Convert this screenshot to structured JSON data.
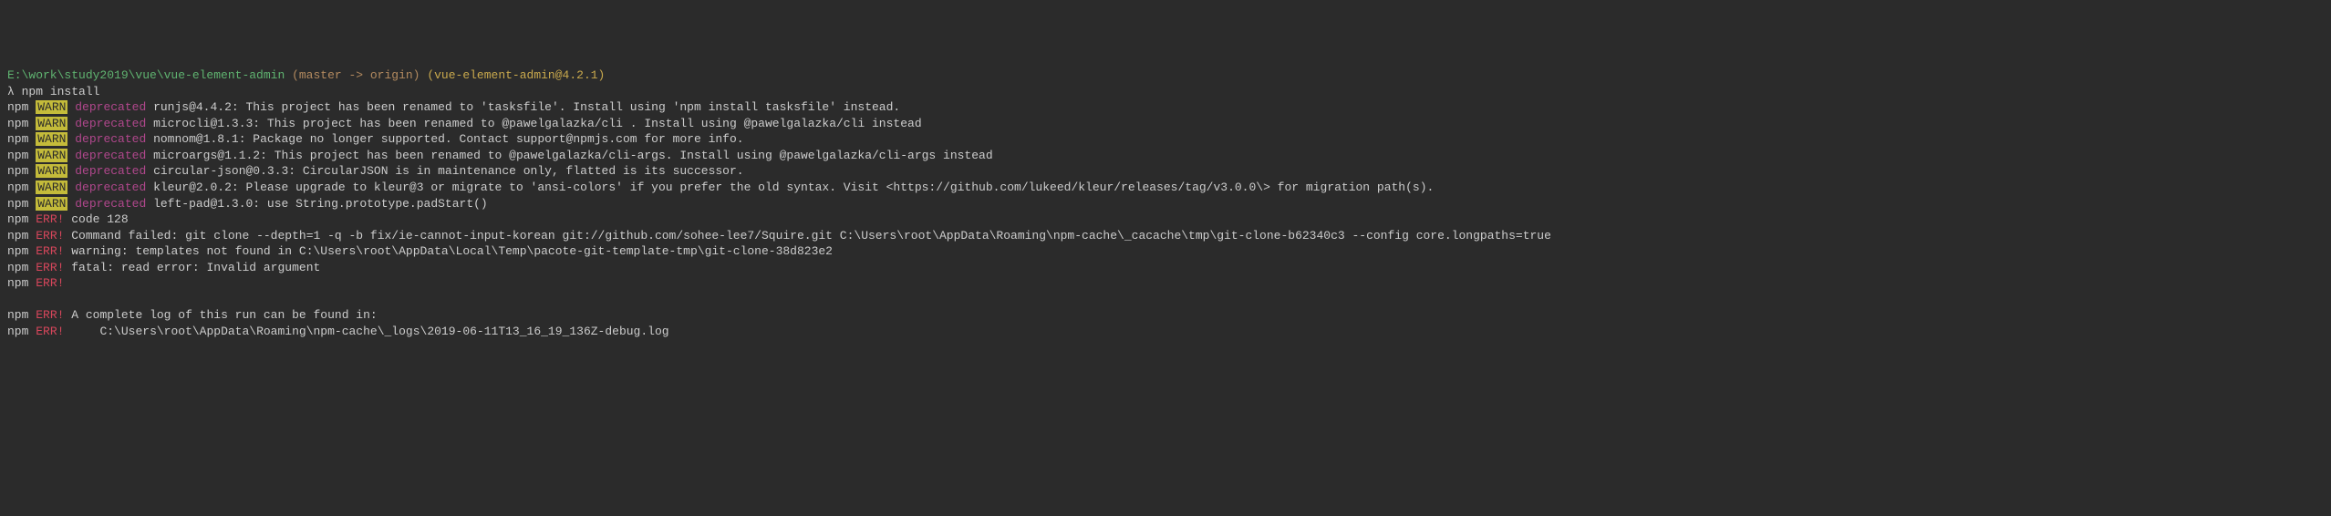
{
  "prompt": {
    "path": "E:\\work\\study2019\\vue\\vue-element-admin",
    "branch": "(master -> origin)",
    "version": "(vue-element-admin@4.2.1)",
    "symbol": "λ",
    "command": "npm install"
  },
  "labels": {
    "npm": "npm",
    "warn": "WARN",
    "err": "ERR!",
    "deprecated": "deprecated"
  },
  "warns": [
    "runjs@4.4.2: This project has been renamed to 'tasksfile'. Install using 'npm install tasksfile' instead.",
    "microcli@1.3.3: This project has been renamed to @pawelgalazka/cli . Install using @pawelgalazka/cli instead",
    "nomnom@1.8.1: Package no longer supported. Contact support@npmjs.com for more info.",
    "microargs@1.1.2: This project has been renamed to @pawelgalazka/cli-args. Install using @pawelgalazka/cli-args instead",
    "circular-json@0.3.3: CircularJSON is in maintenance only, flatted is its successor.",
    "kleur@2.0.2: Please upgrade to kleur@3 or migrate to 'ansi-colors' if you prefer the old syntax. Visit <https://github.com/lukeed/kleur/releases/tag/v3.0.0\\> for migration path(s).",
    "left-pad@1.3.0: use String.prototype.padStart()"
  ],
  "errs": [
    "code 128",
    "Command failed: git clone --depth=1 -q -b fix/ie-cannot-input-korean git://github.com/sohee-lee7/Squire.git C:\\Users\\root\\AppData\\Roaming\\npm-cache\\_cacache\\tmp\\git-clone-b62340c3 --config core.longpaths=true",
    "warning: templates not found in C:\\Users\\root\\AppData\\Local\\Temp\\pacote-git-template-tmp\\git-clone-38d823e2",
    "fatal: read error: Invalid argument",
    "",
    "",
    "A complete log of this run can be found in:",
    "    C:\\Users\\root\\AppData\\Roaming\\npm-cache\\_logs\\2019-06-11T13_16_19_136Z-debug.log"
  ]
}
